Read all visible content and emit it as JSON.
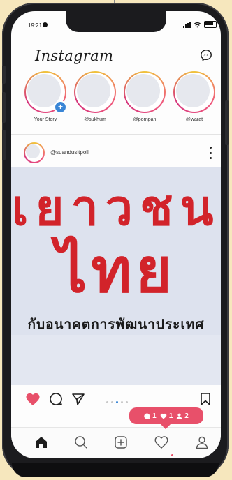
{
  "status_bar": {
    "time": "19:21"
  },
  "header": {
    "logo": "Instagram"
  },
  "stories": [
    {
      "label": "Your Story",
      "own": true
    },
    {
      "label": "@sukhum"
    },
    {
      "label": "@pornpan"
    },
    {
      "label": "@warat"
    }
  ],
  "post": {
    "username": "@suandusitpoll",
    "headline_1": "เยาวชน",
    "headline_2": "ไทย",
    "headline_3": "กับอนาคตการพัฒนาประเทศ",
    "carousel": {
      "count": 5,
      "active_index": 2
    }
  },
  "notification": {
    "comments": "1",
    "likes": "1",
    "follows": "2"
  },
  "icons": {
    "messenger": "messenger-icon",
    "like": "heart-icon",
    "comment": "comment-icon",
    "share": "send-icon",
    "save": "bookmark-icon",
    "home": "home-icon",
    "search": "search-icon",
    "add": "add-post-icon",
    "activity": "heart-outline-icon",
    "profile": "profile-icon"
  },
  "colors": {
    "like": "#e8506a",
    "headline": "#d2232a",
    "notification": "#e8506a",
    "accent": "#3a86d6"
  }
}
